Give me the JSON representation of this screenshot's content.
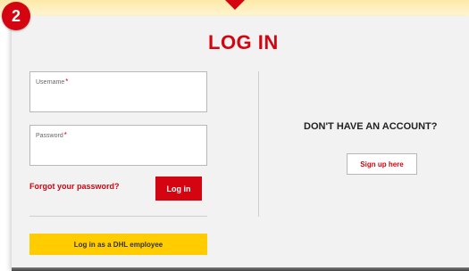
{
  "step_badge": "2",
  "title": "LOG IN",
  "login_form": {
    "username": {
      "label": "Username",
      "required_mark": "*",
      "value": ""
    },
    "password": {
      "label": "Password",
      "required_mark": "*",
      "value": ""
    },
    "forgot_link": "Forgot your password?",
    "login_button": "Log in",
    "employee_button": "Log in as a DHL employee"
  },
  "signup": {
    "heading": "DON'T HAVE AN ACCOUNT?",
    "button": "Sign up here"
  },
  "colors": {
    "brand_red": "#d40511",
    "brand_yellow": "#ffcc00",
    "panel_bg": "#f2f2f2"
  }
}
